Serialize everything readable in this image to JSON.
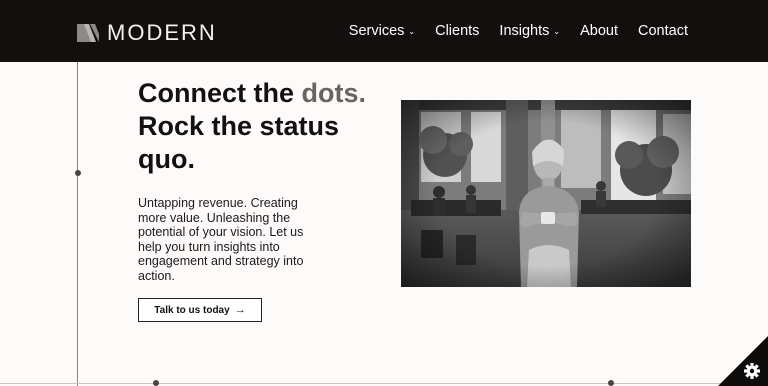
{
  "header": {
    "logo_text": "MODERN",
    "nav": [
      {
        "label": "Services",
        "has_dropdown": true
      },
      {
        "label": "Clients",
        "has_dropdown": false
      },
      {
        "label": "Insights",
        "has_dropdown": true
      },
      {
        "label": "About",
        "has_dropdown": false
      },
      {
        "label": "Contact",
        "has_dropdown": false
      }
    ],
    "dropdown_icon": "chevron-down-icon"
  },
  "hero": {
    "headline_part1": "Connect the ",
    "headline_accent": "dots.",
    "headline_part2": "Rock the status quo.",
    "body": "Untapping revenue. Creating more value. Unleashing the potential of your vision. Let us help you turn insights into engagement and strategy into action.",
    "cta_label": "Talk to us today",
    "cta_icon": "arrow-right-icon",
    "image_icon": "office-woman-photo"
  },
  "corner_icon": "gear-icon",
  "colors": {
    "header_bg": "#130f0e",
    "page_bg": "#fdfbfa",
    "accent_text": "#6a6461"
  }
}
